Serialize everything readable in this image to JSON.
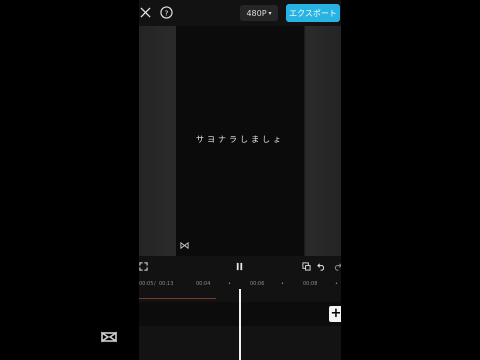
{
  "topbar": {
    "close_icon": "close-icon",
    "help_icon": "help-icon",
    "resolution_label": "480P",
    "resolution_caret": "▾",
    "export_label": "エクスポート"
  },
  "preview": {
    "caption": "サヨナラしましょ",
    "watermark_icon": "capcut-logo-icon"
  },
  "controls": {
    "fullscreen_icon": "fullscreen-icon",
    "pause_icon": "pause-icon",
    "keyframe_icon": "keyframe-icon",
    "undo_icon": "undo-icon",
    "redo_icon": "redo-icon"
  },
  "timeline": {
    "current_time": "00:05",
    "total_time": "00:13",
    "ruler_labels": [
      "00:04",
      "00:06",
      "00:08"
    ],
    "progress_fraction": 0.38,
    "add_label": "+"
  },
  "colors": {
    "accent": "#27b4e3",
    "background": "#121212"
  }
}
